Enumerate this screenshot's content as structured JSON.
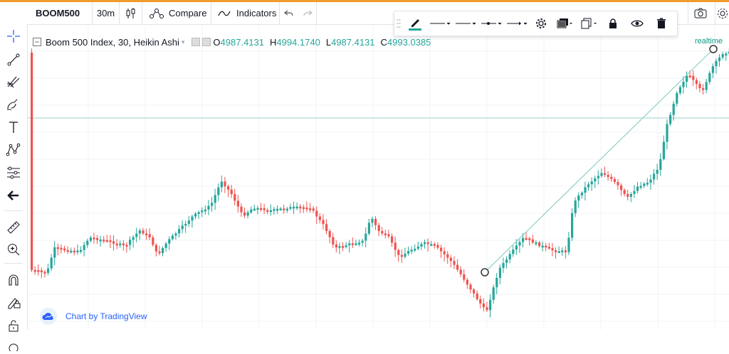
{
  "header": {
    "symbol": "BOOM500",
    "interval": "30m",
    "compare_label": "Compare",
    "indicators_label": "Indicators"
  },
  "legend": {
    "title": "Boom 500 Index, 30, Heikin Ashi",
    "open_label": "O",
    "open": "4987.4131",
    "high_label": "H",
    "high": "4994.1740",
    "low_label": "L",
    "low": "4987.4131",
    "close_label": "C",
    "close": "4993.0385"
  },
  "chart": {
    "realtime_label": "realtime",
    "watermark": "Chart by TradingView"
  },
  "colors": {
    "up": "#26a69a",
    "down": "#ef5350",
    "accent": "#f39b2f",
    "grid": "#f0f3fa"
  },
  "left_toolbar": [
    "crosshair-icon",
    "trend-line-icon",
    "pitchfork-icon",
    "brush-icon",
    "text-icon",
    "pattern-icon",
    "prediction-icon",
    "back-arrow-icon",
    "ruler-icon",
    "zoom-in-icon",
    "magnet-icon",
    "lock-drawings-icon",
    "lock-icon",
    "eye-icon"
  ],
  "floating_toolbar": [
    "pencil-icon",
    "line-style-dropdown",
    "line-width-dropdown",
    "line-start-dropdown",
    "line-end-dropdown",
    "gear-icon",
    "layers-icon",
    "clone-icon",
    "lock-icon",
    "eye-icon",
    "trash-icon"
  ]
}
